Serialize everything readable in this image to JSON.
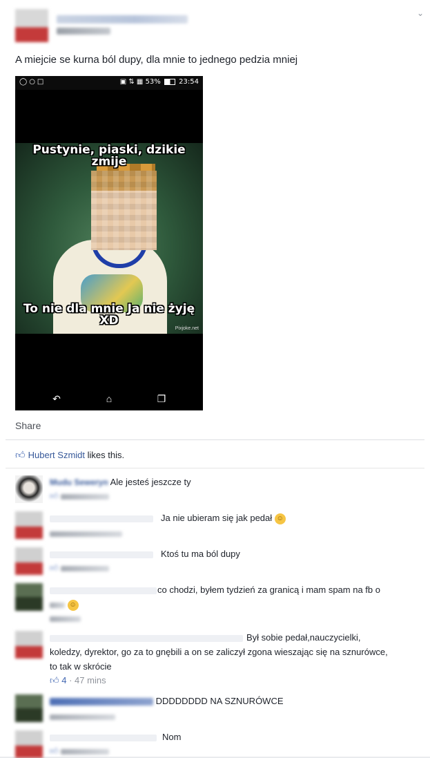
{
  "post": {
    "text": "A miejcie se kurna ból dupy, dla mnie to jednego pedzia mniej",
    "menu_icon": "chevron-down-icon"
  },
  "screenshot": {
    "status_time": "23:54",
    "battery": "53%",
    "meme_top": "Pustynie, piaski, dzikie zmije",
    "meme_bottom": "To nie dla mnie Ja nie żyję XD",
    "watermark": "Pixjoke.net"
  },
  "actions": {
    "share_label": "Share"
  },
  "likes": {
    "liker": "Hubert Szmidt",
    "suffix": " likes this."
  },
  "comments": [
    {
      "name": "Mudu Seweryn",
      "text": "Ale jesteś jeszcze ty"
    },
    {
      "text": "Ja nie ubieram się jak pedał"
    },
    {
      "text": "Ktoś tu ma ból dupy"
    },
    {
      "text": "co chodzi, byłem tydzień za granicą i mam spam na fb o"
    },
    {
      "text_line1": "Był sobie pedał,nauczycielki,",
      "text_rest": "koledzy, dyrektor, go za to gnębili a on se zaliczył zgona wieszając się na sznurówce, to tak w skrócie",
      "likes": "4",
      "time": "47 mins"
    },
    {
      "text": "DDDDDDDD NA SZNURÓWCE"
    },
    {
      "text": "Nom"
    }
  ]
}
